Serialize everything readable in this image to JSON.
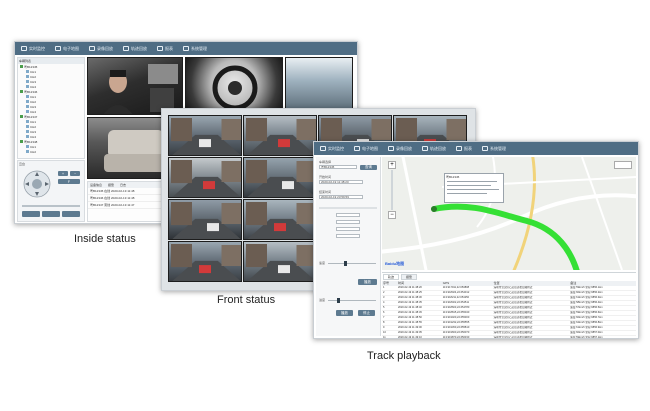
{
  "toolbar": {
    "items": [
      {
        "label": "实时监控",
        "icon": "monitor-icon"
      },
      {
        "label": "电子地图",
        "icon": "map-icon"
      },
      {
        "label": "录像回放",
        "icon": "playback-icon"
      },
      {
        "label": "轨迹回放",
        "icon": "track-icon"
      },
      {
        "label": "报表",
        "icon": "report-icon"
      },
      {
        "label": "系统管理",
        "icon": "settings-icon"
      }
    ]
  },
  "captions": {
    "inside": "Inside status",
    "front": "Front status",
    "track": "Track playback"
  },
  "track": {
    "map_tooltip_plate": "粤B12345",
    "map_logo": "Baidu地图",
    "zoom_plus": "+",
    "zoom_minus": "−",
    "query_button": "查询",
    "tabs": [
      "轨迹",
      "报警"
    ],
    "table_headers": [
      "序号",
      "时间",
      "GPS",
      "位置",
      "备注"
    ],
    "table_rows": [
      [
        "1",
        "2020-02-19 11:48:20",
        "113.917911,22.653808",
        "深圳市宝安区石岩街道松白路附近",
        "速度:59km/h 里程:9856.1km"
      ],
      [
        "2",
        "2020-02-19 11:48:25",
        "113.918024,22.654012",
        "深圳市宝安区石岩街道松白路附近",
        "速度:60km/h 里程:9856.2km"
      ],
      [
        "3",
        "2020-02-19 11:48:30",
        "113.918211,22.654250",
        "深圳市宝安区石岩街道松白路附近",
        "速度:61km/h 里程:9856.3km"
      ],
      [
        "4",
        "2020-02-19 11:48:35",
        "113.918402,22.654511",
        "深圳市宝安区石岩街道松白路附近",
        "速度:58km/h 里程:9856.4km"
      ],
      [
        "5",
        "2020-02-19 11:48:40",
        "113.918603,22.654780",
        "深圳市宝安区石岩街道松白路附近",
        "速度:57km/h 里程:9856.5km"
      ],
      [
        "6",
        "2020-02-19 11:48:45",
        "113.918815,22.655040",
        "深圳市宝安区石岩街道松白路附近",
        "速度:59km/h 里程:9856.6km"
      ],
      [
        "7",
        "2020-02-19 11:48:50",
        "113.919020,22.655300",
        "深圳市宝安区石岩街道松白路附近",
        "速度:60km/h 里程:9856.7km"
      ],
      [
        "8",
        "2020-02-19 11:48:55",
        "113.919232,22.655555",
        "深圳市宝安区石岩街道松白路附近",
        "速度:62km/h 里程:9856.8km"
      ],
      [
        "9",
        "2020-02-19 11:49:00",
        "113.919450,22.655810",
        "深圳市宝安区石岩街道松白路附近",
        "速度:61km/h 里程:9856.9km"
      ],
      [
        "10",
        "2020-02-19 11:49:05",
        "113.919660,22.656070",
        "深圳市宝安区石岩街道松白路附近",
        "速度:60km/h 里程:9857.0km"
      ],
      [
        "11",
        "2020-02-19 11:49:10",
        "113.919870,22.656330",
        "深圳市宝安区石岩街道松白路附近",
        "速度:59km/h 里程:9857.1km"
      ]
    ],
    "form": {
      "vehicle_label": "车辆选择",
      "vehicle_value": "粤B12345",
      "start_label": "开始时间",
      "start_value": "2020-02-19 11:48:20",
      "end_label": "结束时间",
      "end_value": "2020-02-19 23:59:59",
      "speed_label": "速度",
      "play_button": "播放",
      "stop_button": "停止",
      "speed_slider_fraction": 0.35,
      "progress_label": "进度",
      "progress_fraction": 0.2
    }
  },
  "inside": {
    "tree_header": "车辆列表",
    "tree_items": [
      "粤B12345",
      "CH1",
      "CH2",
      "CH3",
      "CH4",
      "粤B12346",
      "CH1",
      "CH2",
      "CH3",
      "CH4",
      "粤B12347",
      "CH1",
      "CH2",
      "CH3",
      "CH4",
      "粤B12348",
      "CH1",
      "CH2"
    ],
    "ptz_label": "云台",
    "bottom_tabs": [
      "设备信息",
      "报警",
      "日志"
    ],
    "bottom_rows": [
      "粤B12345 在线 2020-02-19 11:48",
      "粤B12346 在线 2020-02-19 11:48",
      "粤B12347 离线 2020-02-19 11:47"
    ]
  },
  "colors": {
    "toolbar": "#4f6d84",
    "track_line": "#35e035",
    "map_road": "#f1d37a",
    "accent_button": "#5d7a90"
  }
}
